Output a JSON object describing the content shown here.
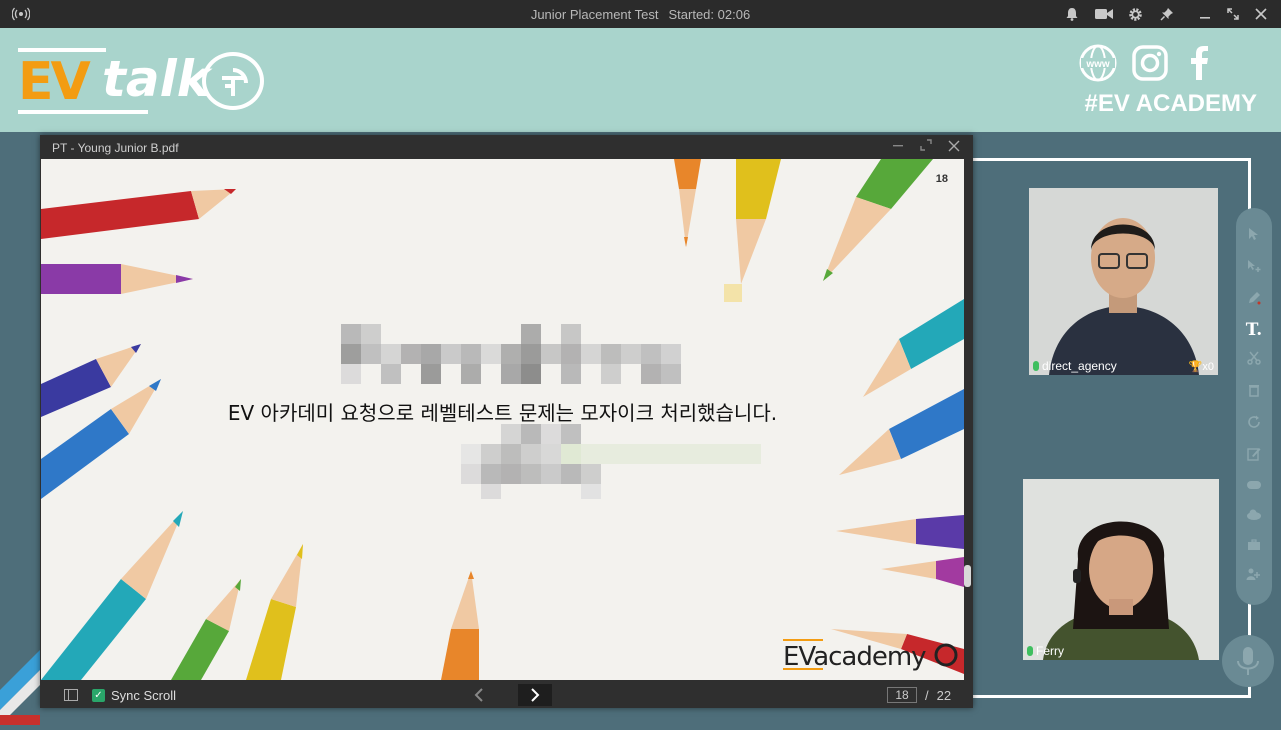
{
  "titlebar": {
    "broadcast_icon": "broadcast-icon",
    "test_name": "Junior Placement Test",
    "started": "Started: 02:06",
    "icons": [
      "bell-icon",
      "camera-icon",
      "gear-icon",
      "pin-icon",
      "minimize-icon",
      "restore-icon",
      "close-icon"
    ]
  },
  "banner": {
    "logo_ev": "EV",
    "logo_talk": "talk",
    "hashtag": "#EV ACADEMY",
    "social_icons": [
      "www-icon",
      "instagram-icon",
      "facebook-icon"
    ],
    "www_text": "www"
  },
  "pdf": {
    "filename": "PT - Young Junior B.pdf",
    "page_badge": "18",
    "caption": "EV 아카데미 요청으로 레벨테스트 문제는 모자이크 처리했습니다.",
    "brand": "EVacademy",
    "footer": {
      "sync_label": "Sync Scroll",
      "current_page": "18",
      "separator": "/",
      "total_pages": "22"
    }
  },
  "participants": [
    {
      "name": "direct_agency",
      "trophy": "x0"
    },
    {
      "name": "Ferry"
    }
  ],
  "toolbar": {
    "tools": [
      "cursor-icon",
      "pointer-icon",
      "pen-icon",
      "text-icon",
      "scissors-icon",
      "trash-icon",
      "refresh-icon",
      "edit-icon",
      "gamepad-icon",
      "cloud-icon",
      "briefcase-icon",
      "users-icon"
    ],
    "text_tool": "T."
  },
  "colors": {
    "banner_bg": "#a9d4cc",
    "stage_bg": "#4e6e7a",
    "logo_orange": "#f39c12",
    "titlebar_bg": "#2b2b2b"
  }
}
